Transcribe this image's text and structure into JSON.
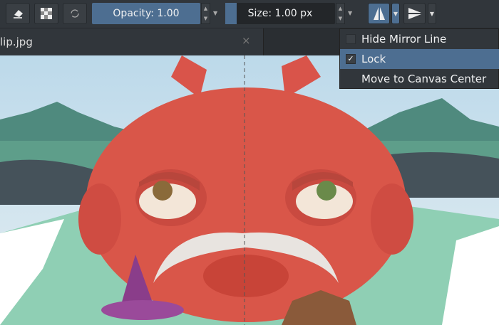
{
  "toolbar": {
    "opacity_label": "Opacity:  1.00",
    "size_label": "Size:  1.00 px",
    "opacity_fraction": 1.0,
    "accent": "#4d6e91"
  },
  "tab": {
    "filename": "lip.jpg",
    "close": "×"
  },
  "mirror_menu": {
    "items": [
      {
        "label": "Hide Mirror Line",
        "checked": false
      },
      {
        "label": "Lock",
        "checked": true,
        "check": "✓"
      },
      {
        "label": "Move to Canvas Center"
      }
    ]
  }
}
